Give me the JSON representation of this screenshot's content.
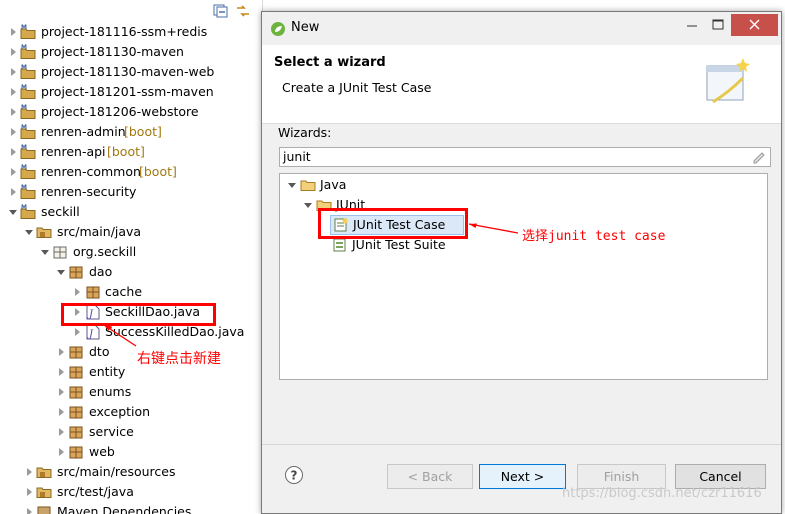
{
  "explorer": {
    "items": [
      {
        "label": "project-181116-ssm+redis"
      },
      {
        "label": "project-181130-maven"
      },
      {
        "label": "project-181130-maven-web"
      },
      {
        "label": "project-181201-ssm-maven"
      },
      {
        "label": "project-181206-webstore"
      },
      {
        "label": "renren-admin",
        "tag": "[boot]"
      },
      {
        "label": "renren-api",
        "tag": "[boot]"
      },
      {
        "label": "renren-common",
        "tag": "[boot]"
      },
      {
        "label": "renren-security"
      },
      {
        "label": "seckill"
      },
      {
        "label": "src/main/java"
      },
      {
        "label": "org.seckill"
      },
      {
        "label": "dao"
      },
      {
        "label": "cache"
      },
      {
        "label": "SeckillDao.java"
      },
      {
        "label": "SuccessKilledDao.java"
      },
      {
        "label": "dto"
      },
      {
        "label": "entity"
      },
      {
        "label": "enums"
      },
      {
        "label": "exception"
      },
      {
        "label": "service"
      },
      {
        "label": "web"
      },
      {
        "label": "src/main/resources"
      },
      {
        "label": "src/test/java"
      },
      {
        "label": "Maven Dependencies"
      }
    ]
  },
  "dialog": {
    "title": "New",
    "header_title": "Select a wizard",
    "header_subtitle": "Create a JUnit Test Case",
    "wizards_label": "Wizards:",
    "filter_value": "junit",
    "tree": [
      {
        "label": "Java"
      },
      {
        "label": "JUnit"
      },
      {
        "label": "JUnit Test Case"
      },
      {
        "label": "JUnit Test Suite"
      }
    ],
    "buttons": {
      "help": "?",
      "back": "< Back",
      "next": "Next >",
      "finish": "Finish",
      "cancel": "Cancel"
    }
  },
  "annotations": {
    "right_click_note": "右键点击新建",
    "select_note": "选择junit test case"
  },
  "watermark": "https://blog.csdn.net/czr11616",
  "colors": {
    "highlight": "#ff0000",
    "close_button": "#c7504b",
    "boot_tag": "#a1790f",
    "default_button_border": "#0078d7"
  }
}
